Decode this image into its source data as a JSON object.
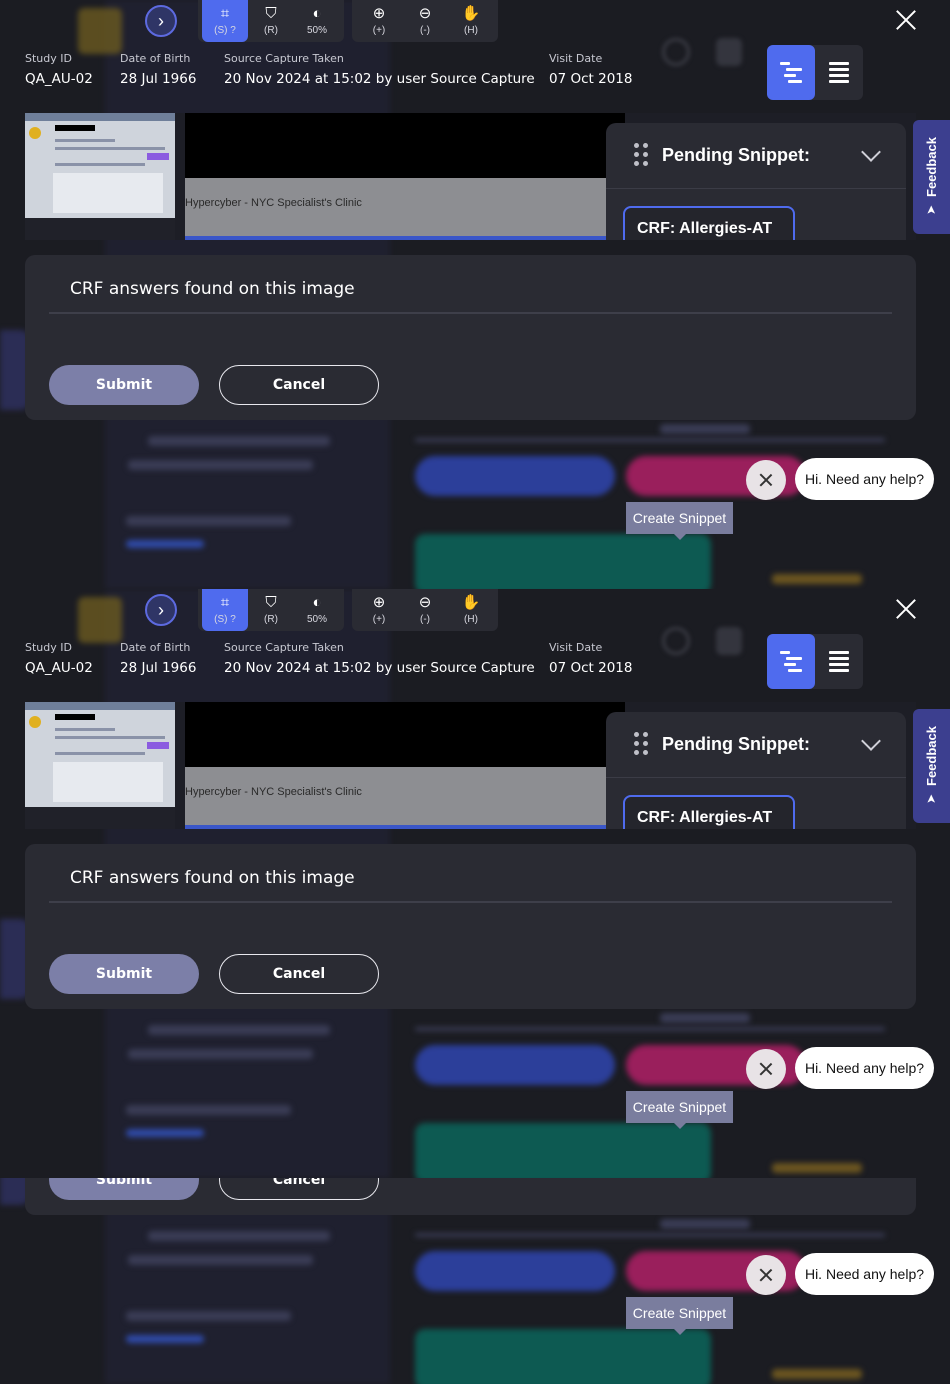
{
  "toolbar": {
    "tools": [
      {
        "icon": "crop-icon",
        "label": "(S)",
        "help": "?"
      },
      {
        "icon": "flask-icon",
        "label": "(R)"
      },
      {
        "icon": "drop-icon",
        "label": "50%"
      },
      {
        "icon": "zoom-in-icon",
        "label": "(+)"
      },
      {
        "icon": "zoom-out-icon",
        "label": "(-)"
      },
      {
        "icon": "hand-icon",
        "label": "(H)"
      }
    ]
  },
  "meta": {
    "study_id_label": "Study ID",
    "study_id": "QA_AU-02",
    "dob_label": "Date of Birth",
    "dob": "28 Jul 1966",
    "source_label": "Source Capture Taken",
    "source": "20 Nov 2024 at 15:02 by user Source Capture",
    "visit_label": "Visit Date",
    "visit": "07 Oct 2018"
  },
  "document": {
    "clinic_text": "Hypercyber - NYC Specialist's Clinic"
  },
  "pending": {
    "title": "Pending Snippet:",
    "crf_item": "CRF: Allergies-AT"
  },
  "feedback": {
    "label": "Feedback"
  },
  "crf_panel": {
    "title": "CRF answers found on this image",
    "submit": "Submit",
    "cancel": "Cancel"
  },
  "help": {
    "bubble": "Hi. Need any help?"
  },
  "tooltip": {
    "create_snippet": "Create Snippet"
  },
  "colors": {
    "accent": "#4f6bee",
    "panel": "#2a2b33",
    "feedback": "#3c3f8f",
    "submit": "#7c7fa8"
  }
}
